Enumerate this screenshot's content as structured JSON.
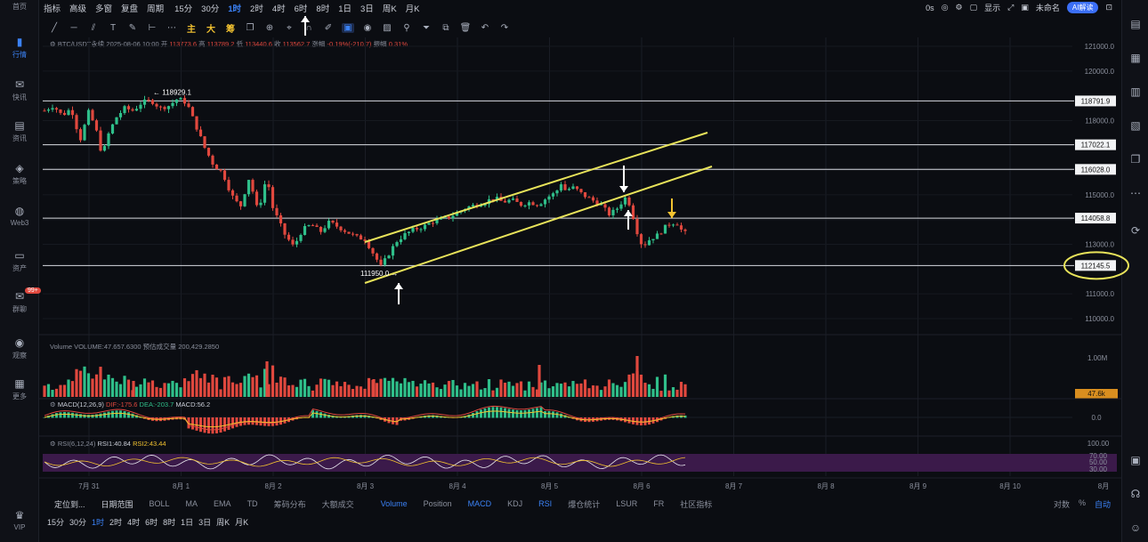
{
  "left_sidebar": {
    "items": [
      {
        "label": "首页",
        "icon": "home-icon"
      },
      {
        "label": "行情",
        "icon": "chart-bars-icon",
        "active": true
      },
      {
        "label": "快讯",
        "icon": "news-icon"
      },
      {
        "label": "资讯",
        "icon": "document-icon"
      },
      {
        "label": "策略",
        "icon": "strategy-icon"
      },
      {
        "label": "Web3",
        "icon": "globe-icon"
      },
      {
        "label": "资产",
        "icon": "wallet-icon"
      },
      {
        "label": "群聊",
        "icon": "chat-icon",
        "badge": "99+"
      },
      {
        "label": "观察",
        "icon": "watch-icon"
      },
      {
        "label": "更多",
        "icon": "grid-icon"
      },
      {
        "label": "VIP",
        "icon": "vip-crown-icon"
      }
    ]
  },
  "topbar": {
    "items": [
      "指标",
      "高级",
      "多窗",
      "复盘",
      "周期",
      "15分",
      "30分",
      "1时",
      "2时",
      "4时",
      "6时",
      "8时",
      "1日",
      "3日",
      "周K",
      "月K"
    ],
    "selected": "1时",
    "right": {
      "timer": "0s",
      "display": "显示",
      "unnamed": "未命名",
      "ai": "AI解读"
    }
  },
  "toolbar2": {
    "main": "主",
    "big": "大",
    "chips": "筹"
  },
  "info": {
    "symbol": "BTC/USDT永续 2025-08-06 10:00",
    "open_label": "开",
    "open": "113773.6",
    "high_label": "高",
    "high": "113789.2",
    "low_label": "低",
    "low": "113440.6",
    "close_label": "收",
    "close": "113562.7",
    "change_label": "涨幅",
    "change": "-0.19%(-210.7)",
    "amp_label": "振幅",
    "amp": "0.31%"
  },
  "volume_info": {
    "label": "Volume VOLUME:47.657.6300",
    "extra": "预估成交量 200,429.2850"
  },
  "macd_info": {
    "label": "MACD(12,26,9)",
    "dif": "DIF:-175.6",
    "dea": "DEA:-203.7",
    "macd": "MACD:56.2"
  },
  "rsi_info": {
    "label": "RSI(6,12,24)",
    "rsi1": "RSI1:40.84",
    "rsi2": "RSI2:43.44"
  },
  "price_axis": {
    "ticks": [
      "121000.0",
      "120000.0",
      "118000.0",
      "117000.0",
      "116000.0",
      "115000.0",
      "114000.0",
      "113000.0",
      "111000.0",
      "110000.0"
    ],
    "levels": [
      "118791.9",
      "117022.1",
      "116028.0",
      "114058.8",
      "112145.5"
    ],
    "annotations": {
      "high": "118929.1",
      "low": "111950.0"
    }
  },
  "volume_axis": {
    "top": "1.00M",
    "current": "47.6k"
  },
  "macd_axis": {
    "zero": "0.0"
  },
  "rsi_axis": {
    "ticks": [
      "100.00",
      "70.00",
      "50.00",
      "30.00"
    ]
  },
  "date_axis": {
    "dates": [
      "7月 31",
      "8月 1",
      "8月 2",
      "8月 3",
      "8月 4",
      "8月 5",
      "8月 6",
      "8月 7",
      "8月 8",
      "8月 9",
      "8月 10"
    ],
    "end": "8月"
  },
  "bottom_toolbar1": {
    "items": [
      "定位到...",
      "日期范围",
      "BOLL",
      "MA",
      "EMA",
      "TD",
      "筹码分布",
      "大额成交",
      "Volume",
      "Position",
      "MACD",
      "KDJ",
      "RSI",
      "爆仓统计",
      "LSUR",
      "FR",
      "社区指标"
    ],
    "right": [
      "对数",
      "%",
      "自动"
    ]
  },
  "bottom_toolbar2": {
    "items": [
      "15分",
      "30分",
      "1时",
      "2时",
      "4时",
      "6时",
      "8时",
      "1日",
      "3日",
      "周K",
      "月K"
    ],
    "selected": "1时"
  },
  "colors": {
    "up": "#2fbf8a",
    "down": "#e0483e",
    "channel": "#e8e35a",
    "accent": "#3b82f6",
    "annotation": "#f2c230"
  }
}
